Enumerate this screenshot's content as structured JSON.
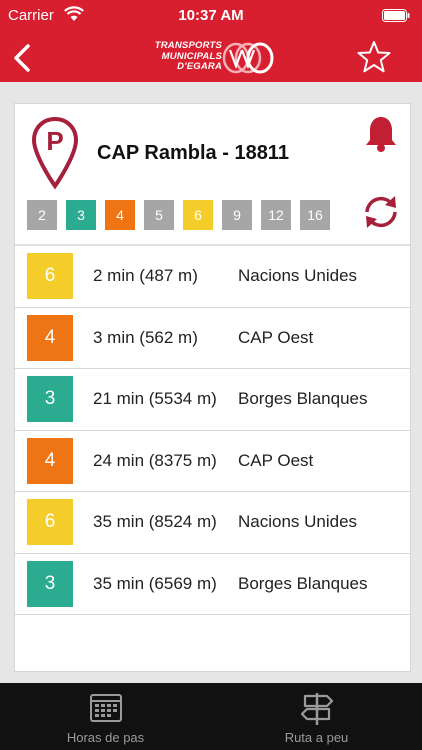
{
  "status_bar": {
    "carrier": "Carrier",
    "time": "10:37 AM"
  },
  "header": {
    "logo_lines": [
      "TRANSPORTS",
      "MUNICIPALS",
      "D'EGARA"
    ],
    "brand_color": "#d71f30"
  },
  "stop": {
    "title": "CAP Rambla - 18811"
  },
  "filters": [
    {
      "label": "2",
      "color": "#a6a6a6"
    },
    {
      "label": "3",
      "color": "#2bab90"
    },
    {
      "label": "4",
      "color": "#ef7414"
    },
    {
      "label": "5",
      "color": "#a6a6a6"
    },
    {
      "label": "6",
      "color": "#f5cd2b"
    },
    {
      "label": "9",
      "color": "#a6a6a6"
    },
    {
      "label": "12",
      "color": "#a6a6a6"
    },
    {
      "label": "16",
      "color": "#a6a6a6"
    }
  ],
  "arrivals": [
    {
      "line": "6",
      "color": "#f5cd2b",
      "eta": "2 min (487 m)",
      "destination": "Nacions Unides"
    },
    {
      "line": "4",
      "color": "#ef7414",
      "eta": "3 min (562 m)",
      "destination": "CAP Oest"
    },
    {
      "line": "3",
      "color": "#2bab90",
      "eta": "21 min (5534 m)",
      "destination": "Borges Blanques"
    },
    {
      "line": "4",
      "color": "#ef7414",
      "eta": "24 min (8375 m)",
      "destination": "CAP Oest"
    },
    {
      "line": "6",
      "color": "#f5cd2b",
      "eta": "35 min (8524 m)",
      "destination": "Nacions Unides"
    },
    {
      "line": "3",
      "color": "#2bab90",
      "eta": "35 min (6569 m)",
      "destination": "Borges Blanques"
    }
  ],
  "tabs": [
    {
      "label": "Horas de pas",
      "icon": "calendar-icon"
    },
    {
      "label": "Ruta a peu",
      "icon": "signpost-icon"
    }
  ]
}
